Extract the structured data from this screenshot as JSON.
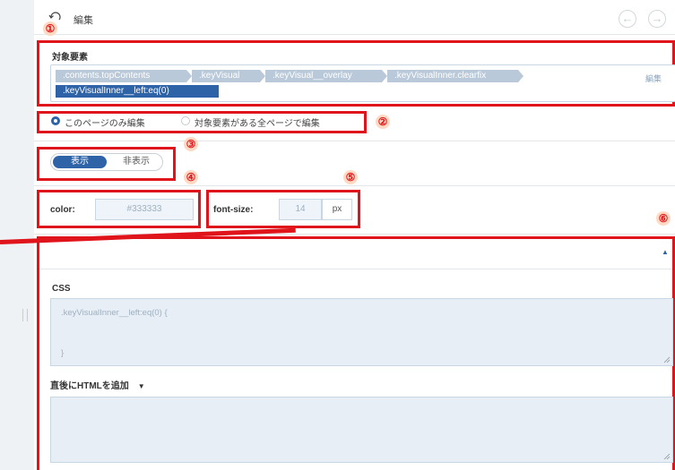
{
  "header": {
    "title": "編集",
    "prev_icon": "arrow-left-icon",
    "next_icon": "arrow-right-icon"
  },
  "markers": [
    "①",
    "②",
    "③",
    "④",
    "⑤",
    "⑥"
  ],
  "target": {
    "label": "対象要素",
    "selectors": [
      ".contents.topContents",
      ".keyVisual",
      ".keyVisual__overlay",
      ".keyVisualInner.clearfix"
    ],
    "active_selector": ".keyVisualInner__left:eq(0)",
    "edit_label": "編集"
  },
  "scope": {
    "options": [
      {
        "label": "このページのみ編集",
        "selected": true
      },
      {
        "label": "対象要素がある全ページで編集",
        "selected": false
      }
    ]
  },
  "visibility": {
    "show_label": "表示",
    "hide_label": "非表示",
    "active": "show"
  },
  "style": {
    "color_label": "color:",
    "color_value": "#333333",
    "font_size_label": "font-size:",
    "font_size_value": "14",
    "font_size_unit": "px"
  },
  "source": {
    "css_label": "CSS",
    "css_line1": ".keyVisualInner__left:eq(0) {",
    "css_line2": "}",
    "html_label": "直後にHTMLを追加",
    "html_value": ""
  },
  "colors": {
    "accent": "#2f63a8",
    "annotation": "#e0141b"
  }
}
